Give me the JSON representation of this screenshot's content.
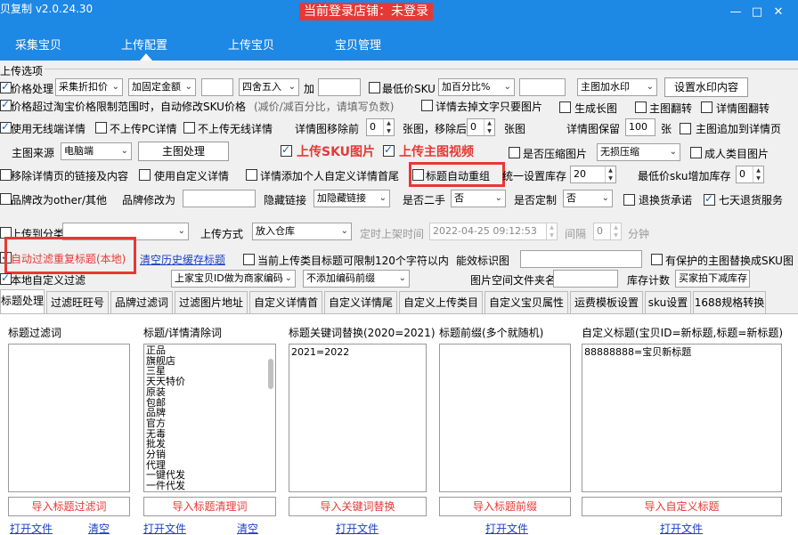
{
  "window": {
    "app_title": "贝复制 v2.0.24.30",
    "store_banner": "当前登录店铺：未登录",
    "minimize": "—",
    "maximize": "□",
    "close": "✕"
  },
  "nav": {
    "items": [
      {
        "label": "采集宝贝"
      },
      {
        "label": "上传配置"
      },
      {
        "label": "上传宝贝"
      },
      {
        "label": "宝贝管理"
      }
    ],
    "active": "上传配置"
  },
  "upload_options": {
    "group_title": "上传选项",
    "row1": {
      "price_processing_label": "价格处理",
      "price_mode": "采集折扣价",
      "price_add": "加固定金额",
      "price_value": "",
      "rounding": "四舍五入",
      "plus_label": "加",
      "plus_value": "",
      "min_sku_label": "最低价SKU",
      "add_percent": "加百分比%",
      "percent_value": "",
      "watermark": "主图加水印",
      "watermark_button": "设置水印内容"
    },
    "row2": {
      "price_exceed_label": "价格超过淘宝价格限制范围时，自动修改SKU价格",
      "price_exceed_hint": "(减价/减百分比，请填写负数)",
      "remove_text_images": "详情去掉文字只要图片",
      "generate_long_image": "生成长图",
      "main_flip": "主图翻转",
      "detail_flip": "详情图翻转"
    },
    "row3": {
      "wireless_detail": "使用无线端详情",
      "no_pc_detail": "不上传PC详情",
      "no_wireless_detail": "不上传无线详情",
      "detail_move_prefix": "详情图移除前",
      "move_prefix_value": "0",
      "move_suffix_label": "张图，移除后",
      "move_suffix_value": "0",
      "pics_label": "张图",
      "detail_keep_label": "详情图保留",
      "detail_keep_value": "100",
      "sheets_label": "张",
      "main_append_detail": "主图追加到详情页"
    },
    "row4": {
      "main_source_label": "主图来源",
      "main_source": "电脑端",
      "main_process_button": "主图处理",
      "upload_sku_images": "上传SKU图片",
      "upload_main_video": "上传主图视频",
      "compress_images": "是否压缩图片",
      "compression": "无损压缩",
      "adult_goods": "成人类目图片"
    },
    "row5": {
      "remove_detail_links": "移除详情页的链接及内容",
      "custom_detail": "使用自定义详情",
      "detail_custom_header": "详情添加个人自定义详情首尾",
      "title_auto_regroup": "标题自动重组",
      "unified_stock_label": "统一设置库存",
      "stock_value": "20",
      "min_sku_stock_label": "最低价sku增加库存",
      "min_sku_stock_value": "0"
    },
    "row6": {
      "brand_other": "品牌改为other/其他",
      "brand_change_label": "品牌修改为",
      "brand_value": "",
      "hidden_link_label": "隐藏链接",
      "hidden_link": "加隐藏链接",
      "second_hand_label": "是否二手",
      "second_hand": "否",
      "custom_made_label": "是否定制",
      "custom_made": "否",
      "return_promise": "退换货承诺",
      "seven_day_return": "七天退货服务"
    },
    "row7": {
      "upload_to_category": "上传到分类",
      "category": "",
      "upload_method_label": "上传方式",
      "upload_method": "放入仓库",
      "scheduled_label": "定时上架时间",
      "scheduled_time": "2022-04-25 09:12:53",
      "interval_label": "间隔",
      "interval_value": "0",
      "minutes_label": "分钟"
    },
    "row8": {
      "auto_filter_duplicate": "自动过滤重复标题(本地)",
      "clear_history": "清空历史缓存标题",
      "current_category_limit": "当前上传类目标题可限制120个字符以内",
      "recognition_label": "能效标识图",
      "recognition_value": "",
      "protected_main_image": "有保护的主图替换成SKU图"
    },
    "row9": {
      "local_custom_filter": "本地自定义过滤",
      "seller_id_mode": "上家宝贝ID做为商家编码",
      "encoding_prefix": "不添加编码前缀",
      "image_folder_label": "图片空间文件夹名",
      "image_folder_value": "",
      "stock_count_label": "库存计数",
      "stock_count": "买家拍下减库存"
    }
  },
  "tabs": [
    {
      "label": "标题处理"
    },
    {
      "label": "过滤旺旺号"
    },
    {
      "label": "品牌过滤词"
    },
    {
      "label": "过滤图片地址"
    },
    {
      "label": "自定义详情首"
    },
    {
      "label": "自定义详情尾"
    },
    {
      "label": "自定义上传类目"
    },
    {
      "label": "自定义宝贝属性"
    },
    {
      "label": "运费模板设置"
    },
    {
      "label": "sku设置"
    },
    {
      "label": "1688规格转换"
    }
  ],
  "title_panel": {
    "columns": [
      {
        "title": "标题过滤词",
        "lines": [],
        "import": "导入标题过滤词",
        "open": "打开文件",
        "clear": "清空"
      },
      {
        "title": "标题/详情清除词",
        "lines": [
          "正品",
          "旗舰店",
          "三星",
          "天天特价",
          "原装",
          "包邮",
          "品牌",
          "官方",
          "无毒",
          "批发",
          "分销",
          "代理",
          "一键代发",
          "一件代发"
        ],
        "import": "导入标题清理词",
        "open": "打开文件",
        "clear": "清空"
      },
      {
        "title": "标题关键词替换(2020=2021)",
        "lines": [
          "2021=2022"
        ],
        "import": "导入关键词替换",
        "open": "打开文件"
      },
      {
        "title": "标题前缀(多个就随机)",
        "lines": [],
        "import": "导入标题前缀",
        "open": "打开文件"
      },
      {
        "title": "自定义标题(宝贝ID=新标题,标题=新标题)",
        "lines": [
          "88888888=宝贝新标题"
        ],
        "import": "导入自定义标题",
        "open": "打开文件"
      }
    ]
  }
}
